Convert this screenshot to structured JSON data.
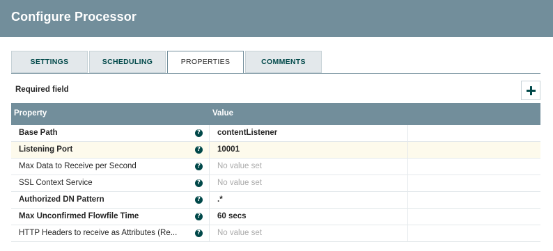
{
  "dialog": {
    "title": "Configure Processor"
  },
  "tabs": [
    {
      "label": "SETTINGS",
      "active": false
    },
    {
      "label": "SCHEDULING",
      "active": false
    },
    {
      "label": "PROPERTIES",
      "active": true
    },
    {
      "label": "COMMENTS",
      "active": false
    }
  ],
  "properties_panel": {
    "required_label": "Required field",
    "add_icon": "plus-icon",
    "columns": {
      "property": "Property",
      "value": "Value"
    },
    "rows": [
      {
        "name": "Base Path",
        "required": true,
        "value": "contentListener",
        "value_set": true,
        "highlighted": false
      },
      {
        "name": "Listening Port",
        "required": true,
        "value": "10001",
        "value_set": true,
        "highlighted": true
      },
      {
        "name": "Max Data to Receive per Second",
        "required": false,
        "value": "No value set",
        "value_set": false,
        "highlighted": false
      },
      {
        "name": "SSL Context Service",
        "required": false,
        "value": "No value set",
        "value_set": false,
        "highlighted": false
      },
      {
        "name": "Authorized DN Pattern",
        "required": true,
        "value": ".*",
        "value_set": true,
        "highlighted": false
      },
      {
        "name": "Max Unconfirmed Flowfile Time",
        "required": true,
        "value": "60 secs",
        "value_set": true,
        "highlighted": false
      },
      {
        "name": "HTTP Headers to receive as Attributes (Re...",
        "required": false,
        "value": "No value set",
        "value_set": false,
        "highlighted": false
      }
    ]
  },
  "colors": {
    "header": "#728e9b",
    "accent": "#004849",
    "highlight_row": "#fdfaec",
    "unset_text": "#aaaaaa"
  }
}
